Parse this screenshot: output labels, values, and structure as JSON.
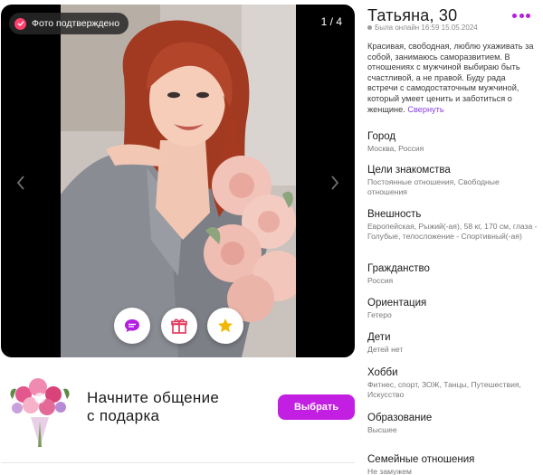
{
  "viewer": {
    "verified_label": "Фото подтверждено",
    "counter": "1 / 4"
  },
  "gift_banner": {
    "title_line1": "Начните общение",
    "title_line2": "с подарка",
    "button_label": "Выбрать"
  },
  "profile": {
    "name": "Татьяна, 30",
    "online": "Была онлайн 16:59 15.05.2024",
    "about": "Красивая, свободная, люблю ухаживать за собой, занимаюсь саморазвитием. В отношениях с мужчиной выбираю быть счастливой, а не правой. Буду рада встречи с самодостаточным мужчиной, который умеет ценить и заботиться о женщине.",
    "collapse_link": "Свернуть",
    "sections": [
      {
        "title": "Город",
        "value": "Москва, Россия"
      },
      {
        "title": "Цели знакомства",
        "value": "Постоянные отношения, Свободные отношения"
      },
      {
        "title": "Внешность",
        "value": "Европейская, Рыжий(-ая), 58 кг, 170 см, глаза - Голубые, телосложение - Спортивный(-ая)"
      },
      {
        "title": "Гражданство",
        "value": "Россия"
      },
      {
        "title": "Ориентация",
        "value": "Гетеро"
      },
      {
        "title": "Дети",
        "value": "Детей нет"
      },
      {
        "title": "Хобби",
        "value": "Фитнес, спорт, ЗОЖ, Танцы, Путешествия, Искусство"
      },
      {
        "title": "Образование",
        "value": "Высшее"
      },
      {
        "title": "Семейные отношения",
        "value": "Не замужем"
      }
    ]
  },
  "icons": {
    "verified": "check-badge-icon",
    "prev": "chevron-left-icon",
    "next": "chevron-right-icon",
    "chat": "chat-bubble-icon",
    "gift": "gift-icon",
    "star": "star-icon",
    "more": "more-dots-icon"
  },
  "colors": {
    "accent": "#c31fe3",
    "verified_badge": "#ff3f6c",
    "star": "#f2b705",
    "link": "#8a3fe0"
  }
}
